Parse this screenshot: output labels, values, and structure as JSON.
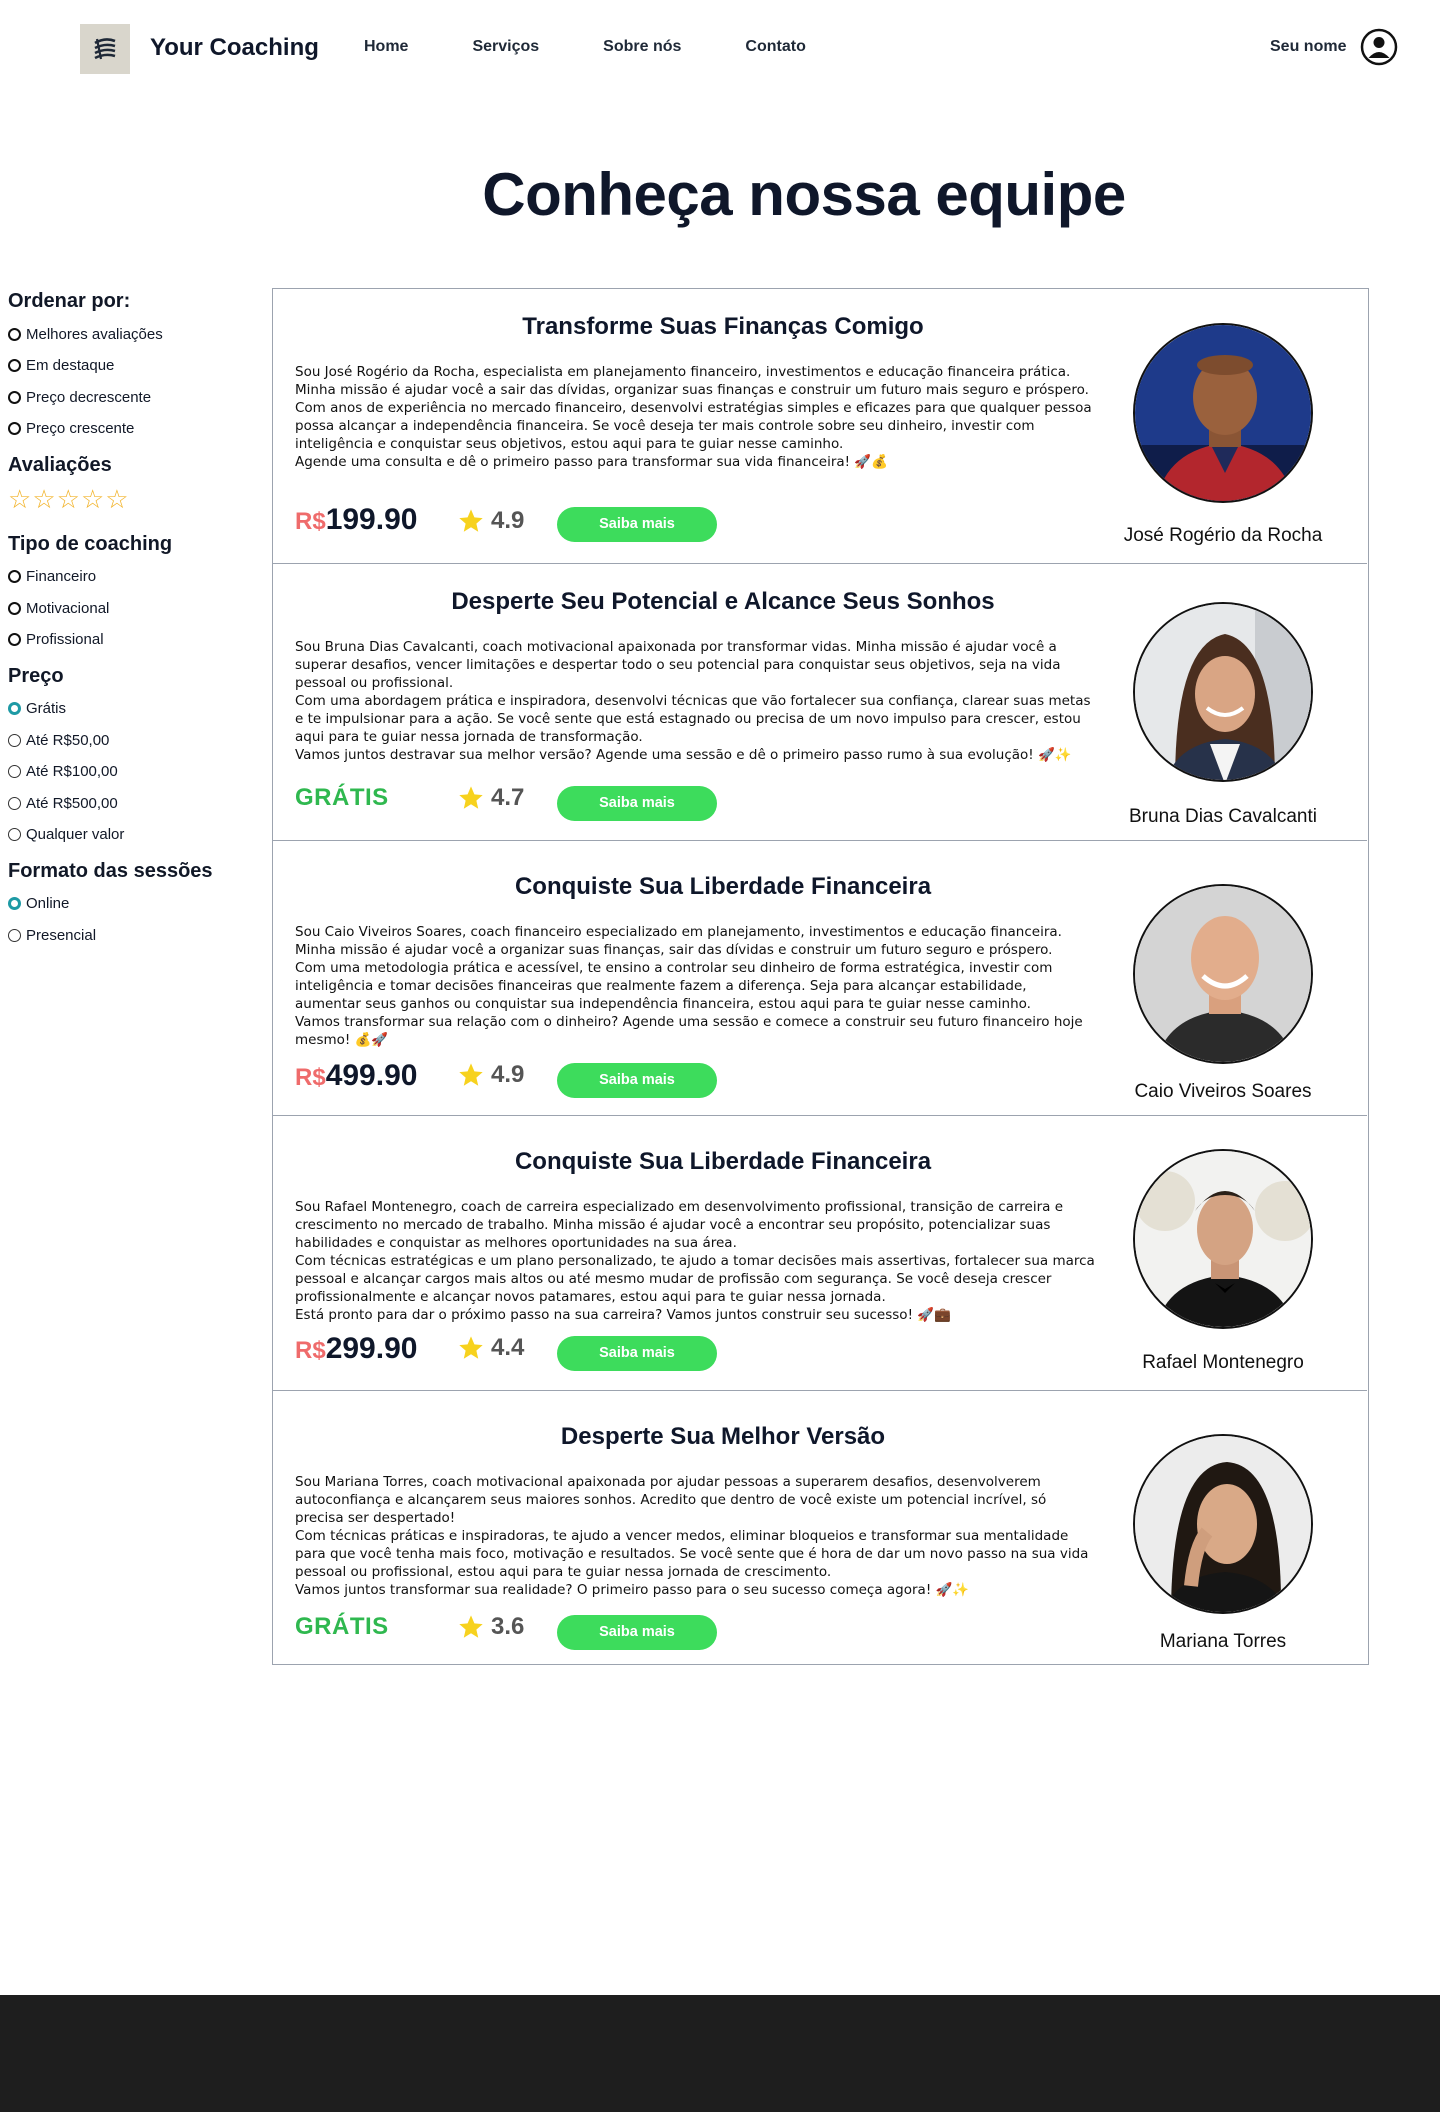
{
  "header": {
    "brand": "Your Coaching",
    "nav": [
      "Home",
      "Serviços",
      "Sobre nós",
      "Contato"
    ],
    "user_name": "Seu nome"
  },
  "page_title": "Conheça nossa equipe",
  "sidebar": {
    "sort": {
      "title": "Ordenar por:",
      "options": [
        "Melhores avaliações",
        "Em destaque",
        "Preço decrescente",
        "Preço crescente"
      ]
    },
    "ratings": {
      "title": "Avaliações",
      "stars": 5
    },
    "type": {
      "title": "Tipo de coaching",
      "options": [
        "Financeiro",
        "Motivacional",
        "Profissional"
      ]
    },
    "price": {
      "title": "Preço",
      "options": [
        "Grátis",
        "Até R$50,00",
        "Até R$100,00",
        "Até R$500,00",
        "Qualquer valor"
      ],
      "selected": "Grátis"
    },
    "format": {
      "title": "Formato das sessões",
      "options": [
        "Online",
        "Presencial"
      ],
      "selected": "Online"
    }
  },
  "currency": "R$",
  "button_label": "Saiba mais",
  "coaches": [
    {
      "title": "Transforme Suas Finanças Comigo",
      "description": "Sou José Rogério da Rocha, especialista em planejamento financeiro, investimentos e educação financeira prática.\nMinha missão é ajudar você a sair das dívidas, organizar suas finanças e construir um futuro mais seguro e próspero.\nCom anos de experiência no mercado financeiro, desenvolvi estratégias simples e eficazes para que qualquer pessoa possa alcançar a independência financeira. Se você deseja ter mais controle sobre seu dinheiro, investir com inteligência e conquistar seus objetivos, estou aqui para te guiar nesse caminho.\nAgende uma consulta e dê o primeiro passo para transformar sua vida financeira! 🚀💰",
      "price": "199.90",
      "free": false,
      "rating": "4.9",
      "name": "José Rogério da Rocha"
    },
    {
      "title": "Desperte Seu Potencial e Alcance Seus Sonhos",
      "description": "Sou Bruna Dias Cavalcanti, coach motivacional apaixonada por transformar vidas. Minha missão é ajudar você a superar desafios, vencer limitações e despertar todo o seu potencial para conquistar seus objetivos, seja na vida pessoal ou profissional.\nCom uma abordagem prática e inspiradora, desenvolvi técnicas que vão fortalecer sua confiança, clarear suas metas e te impulsionar para a ação. Se você sente que está estagnado ou precisa de um novo impulso para crescer, estou aqui para te guiar nessa jornada de transformação.\nVamos juntos destravar sua melhor versão? Agende uma sessão e dê o primeiro passo rumo à sua evolução! 🚀✨",
      "price": "GRÁTIS",
      "free": true,
      "rating": "4.7",
      "name": "Bruna Dias Cavalcanti"
    },
    {
      "title": "Conquiste Sua Liberdade Financeira",
      "description": "Sou Caio Viveiros Soares, coach financeiro especializado em planejamento, investimentos e educação financeira. Minha missão é ajudar você a organizar suas finanças, sair das dívidas e construir um futuro seguro e próspero.\nCom uma metodologia prática e acessível, te ensino a controlar seu dinheiro de forma estratégica, investir com inteligência e tomar decisões financeiras que realmente fazem a diferença. Seja para alcançar estabilidade, aumentar seus ganhos ou conquistar sua independência financeira, estou aqui para te guiar nesse caminho.\nVamos transformar sua relação com o dinheiro? Agende uma sessão e comece a construir seu futuro financeiro hoje mesmo! 💰🚀",
      "price": "499.90",
      "free": false,
      "rating": "4.9",
      "name": "Caio Viveiros Soares"
    },
    {
      "title": "Conquiste Sua Liberdade Financeira",
      "description": "Sou Rafael Montenegro, coach de carreira especializado em desenvolvimento profissional, transição de carreira e crescimento no mercado de trabalho. Minha missão é ajudar você a encontrar seu propósito, potencializar suas habilidades e conquistar as melhores oportunidades na sua área.\nCom técnicas estratégicas e um plano personalizado, te ajudo a tomar decisões mais assertivas, fortalecer sua marca pessoal e alcançar cargos mais altos ou até mesmo mudar de profissão com segurança. Se você deseja crescer profissionalmente e alcançar novos patamares, estou aqui para te guiar nessa jornada.\nEstá pronto para dar o próximo passo na sua carreira? Vamos juntos construir seu sucesso! 🚀💼",
      "price": "299.90",
      "free": false,
      "rating": "4.4",
      "name": "Rafael Montenegro"
    },
    {
      "title": "Desperte Sua Melhor Versão",
      "description": "Sou Mariana Torres, coach motivacional apaixonada por ajudar pessoas a superarem desafios, desenvolverem autoconfiança e alcançarem seus maiores sonhos. Acredito que dentro de você existe um potencial incrível, só precisa ser despertado!\nCom técnicas práticas e inspiradoras, te ajudo a vencer medos, eliminar bloqueios e transformar sua mentalidade para que você tenha mais foco, motivação e resultados. Se você sente que é hora de dar um novo passo na sua vida pessoal ou profissional, estou aqui para te guiar nessa jornada de crescimento.\nVamos juntos transformar sua realidade? O primeiro passo para o seu sucesso começa agora! 🚀✨",
      "price": "GRÁTIS",
      "free": true,
      "rating": "3.6",
      "name": "Mariana Torres"
    }
  ]
}
